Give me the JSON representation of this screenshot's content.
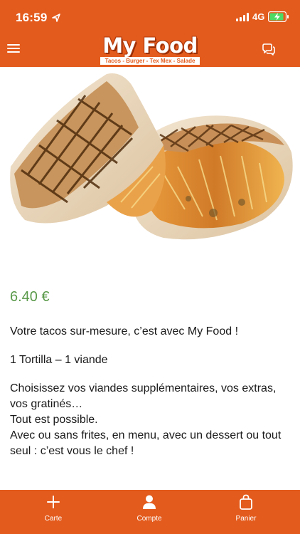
{
  "status_bar": {
    "time": "16:59",
    "network": "4G"
  },
  "header": {
    "logo_title": "My Food",
    "logo_subtitle": "Tacos - Burger - Tex Mex - Salade",
    "menu_icon": "hamburger-menu-icon",
    "chat_icon": "chat-bubbles-icon"
  },
  "product": {
    "image": "tacos-wrap-photo",
    "price": "6.40 €",
    "description": [
      "Votre tacos sur-mesure, c’est avec My Food !",
      "1 Tortilla – 1 viande",
      "Choisissez vos viandes supplémentaires, vos extras, vos gratinés…",
      "Tout est possible.",
      "Avec ou sans frites, en menu, avec un dessert ou tout seul : c’est vous le chef !"
    ]
  },
  "tabs": [
    {
      "label": "Carte",
      "icon": "plus-icon"
    },
    {
      "label": "Compte",
      "icon": "user-icon"
    },
    {
      "label": "Panier",
      "icon": "shopping-bag-icon"
    }
  ],
  "colors": {
    "brand": "#e35b1d",
    "price": "#5a9a4a"
  }
}
